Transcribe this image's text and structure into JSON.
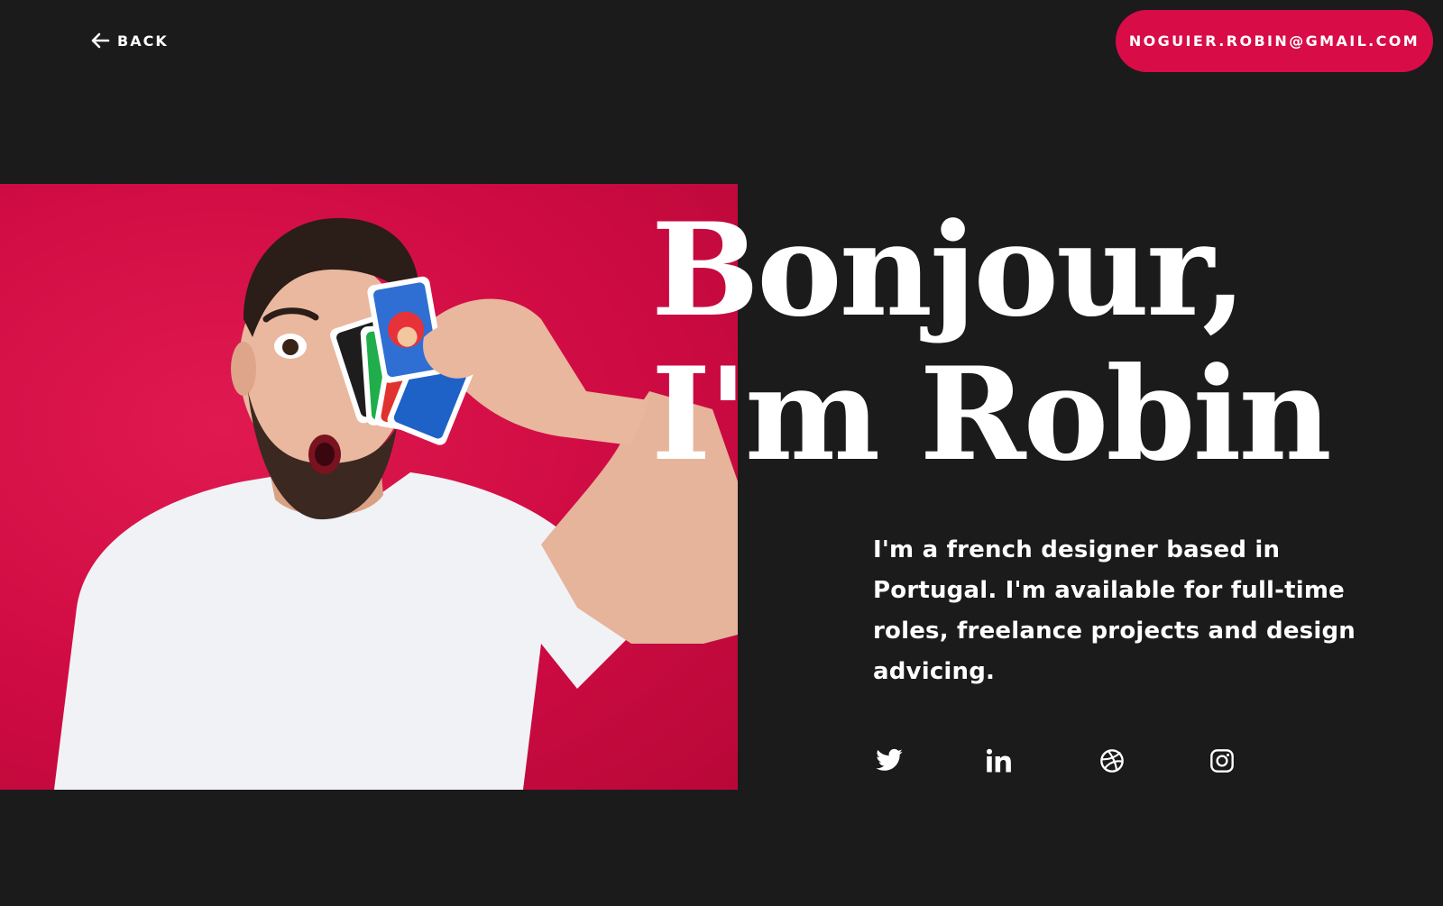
{
  "nav": {
    "back_label": "BACK",
    "back_icon": "arrow-left-icon"
  },
  "header": {
    "email_label": "NOGUIER.ROBIN@GMAIL.COM",
    "email_bg": "#d80c47"
  },
  "hero": {
    "title_line1": "Bonjour,",
    "title_line2": "I'm Robin",
    "bio": "I'm a french designer based in Portugal. I'm available for full-time roles, freelance projects and design advicing.",
    "photo_bg": "#d80c47"
  },
  "socials": [
    {
      "icon": "twitter-icon"
    },
    {
      "icon": "linkedin-icon"
    },
    {
      "icon": "dribbble-icon"
    },
    {
      "icon": "instagram-icon"
    }
  ],
  "colors": {
    "background": "#1b1b1c",
    "accent": "#d80c47",
    "text": "#ffffff"
  }
}
